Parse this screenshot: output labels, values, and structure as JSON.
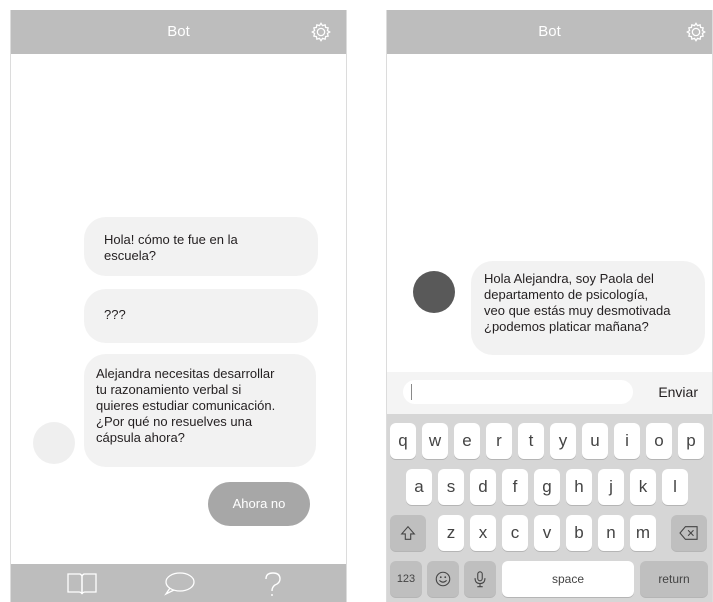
{
  "left_screen": {
    "title": "Bot",
    "messages": [
      {
        "lines": [
          "Hola! cómo te fue en la",
          "escuela?"
        ]
      },
      {
        "lines": [
          "???"
        ]
      },
      {
        "lines": [
          "Alejandra necesitas desarrollar",
          "tu razonamiento verbal si",
          "quieres estudiar comunicación.",
          "¿Por qué no resuelves una",
          "cápsula ahora?"
        ]
      }
    ],
    "reply_button": "Ahora no",
    "nav_icons": [
      "book-icon",
      "chat-bubble-icon",
      "question-icon"
    ]
  },
  "right_screen": {
    "title": "Bot",
    "message": {
      "lines": [
        "Hola Alejandra, soy Paola del",
        "departamento de psicología,",
        "veo que estás muy desmotivada",
        "¿podemos platicar mañana?"
      ]
    },
    "input": {
      "value": "",
      "send_label": "Enviar"
    },
    "keyboard": {
      "row1": [
        "q",
        "w",
        "e",
        "r",
        "t",
        "y",
        "u",
        "i",
        "o",
        "p"
      ],
      "row2": [
        "a",
        "s",
        "d",
        "f",
        "g",
        "h",
        "j",
        "k",
        "l"
      ],
      "row3": [
        "z",
        "x",
        "c",
        "v",
        "b",
        "n",
        "m"
      ],
      "numbers_key": "123",
      "space_key": "space",
      "return_key": "return"
    }
  },
  "colors": {
    "bar": "#bdbdbd",
    "bubble": "#f2f2f2",
    "reply_button": "#a7a7a7",
    "avatar_left": "#efefef",
    "avatar_right": "#595959",
    "keyboard_bg": "#d6d6d6"
  }
}
